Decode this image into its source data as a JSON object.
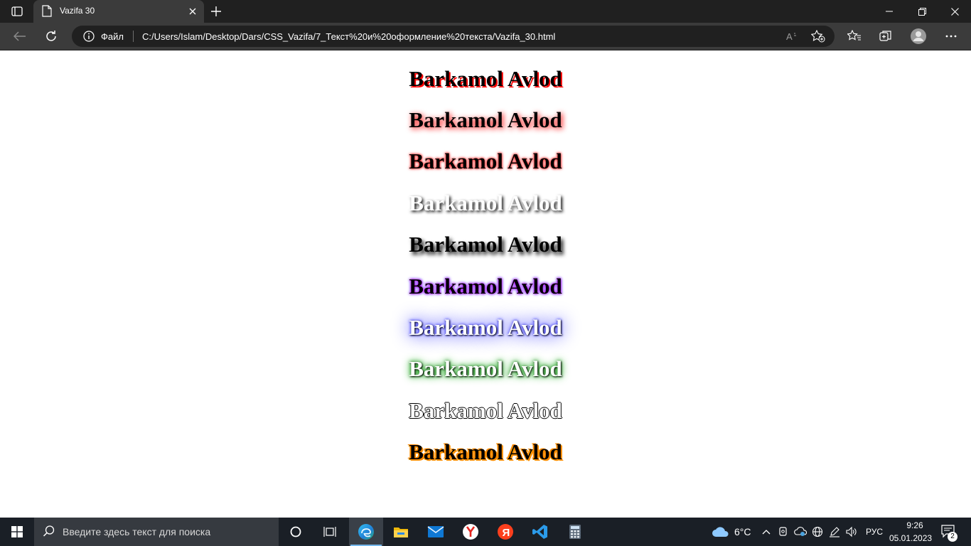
{
  "browser": {
    "tab": {
      "title": "Vazifa 30"
    },
    "address": {
      "site_info_label": "Файл",
      "url": "C:/Users/Islam/Desktop/Dars/CSS_Vazifa/7_Текст%20и%20оформление%20текста/Vazifa_30.html"
    },
    "icons": [
      "tab-actions-icon",
      "page-icon",
      "close-icon",
      "plus-icon",
      "minimize-icon",
      "restore-icon",
      "close-icon",
      "back-arrow-icon",
      "refresh-icon",
      "info-icon",
      "read-aloud-icon",
      "add-favorite-icon",
      "favorites-icon",
      "collections-icon",
      "profile-icon",
      "more-icon"
    ]
  },
  "page": {
    "headings": [
      "Barkamol Avlod",
      "Barkamol Avlod",
      "Barkamol Avlod",
      "Barkamol Avlod",
      "Barkamol Avlod",
      "Barkamol Avlod",
      "Barkamol Avlod",
      "Barkamol Avlod",
      "Barkamol Avlod",
      "Barkamol Avlod"
    ]
  },
  "taskbar": {
    "search_placeholder": "Введите здесь текст для поиска",
    "apps": [
      "cortana-icon",
      "task-view-icon",
      "edge-icon",
      "file-explorer-icon",
      "mail-icon",
      "yandex-browser-icon",
      "yandex-icon",
      "vscode-icon",
      "calculator-icon"
    ],
    "weather": {
      "temperature": "6°C"
    },
    "language": "РУС",
    "clock": {
      "time": "9:26",
      "date": "05.01.2023"
    },
    "notifications_count": "2"
  },
  "colors": {
    "tab_bar": "#202020",
    "toolbar": "#3b3b3b",
    "taskbar": "#1a1f26",
    "accent": "#76b9ed"
  }
}
